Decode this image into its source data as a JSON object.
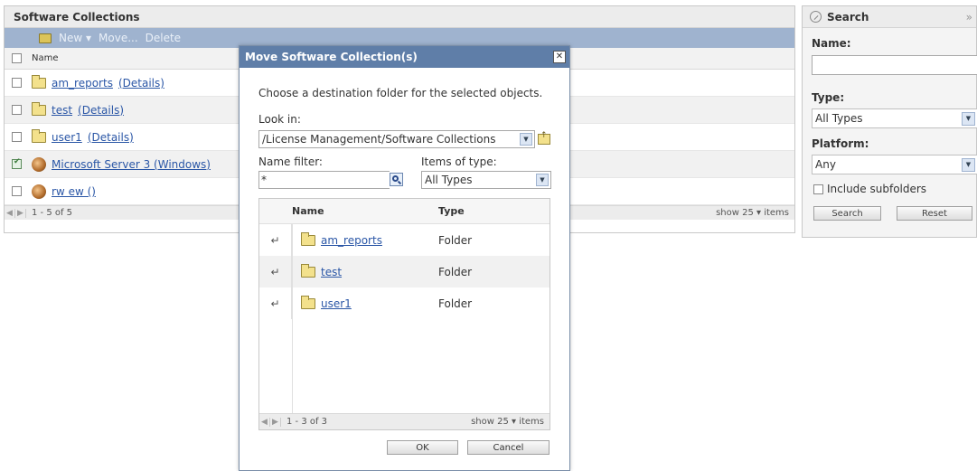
{
  "main": {
    "title": "Software Collections",
    "toolbar": {
      "new": "New ▾",
      "move": "Move...",
      "delete": "Delete"
    },
    "column_name": "Name",
    "rows": [
      {
        "name": "am_reports",
        "details": "(Details)",
        "checked": false
      },
      {
        "name": "test",
        "details": "(Details)",
        "checked": false
      },
      {
        "name": "user1",
        "details": "(Details)",
        "checked": false
      },
      {
        "name": "Microsoft Server 3 (Windows)",
        "details": "",
        "checked": true
      },
      {
        "name": "rw ew ()",
        "details": "",
        "checked": false
      }
    ],
    "pager_text": "1 - 5 of 5",
    "show_text": "show  25 ▾  items"
  },
  "search": {
    "title": "Search",
    "collapse": "»",
    "name_label": "Name:",
    "name_value": "",
    "type_label": "Type:",
    "type_value": "All Types",
    "platform_label": "Platform:",
    "platform_value": "Any",
    "subfolders_label": "Include subfolders",
    "search_button": "Search",
    "reset_button": "Reset"
  },
  "dialog": {
    "title": "Move Software Collection(s)",
    "close": "✕",
    "instruction": "Choose a destination folder for the selected objects.",
    "look_in_label": "Look in:",
    "look_in_value": "/License Management/Software Collections",
    "name_filter_label": "Name filter:",
    "name_filter_value": "*",
    "items_of_type_label": "Items of type:",
    "items_of_type_value": "All Types",
    "col_name": "Name",
    "col_type": "Type",
    "rows": [
      {
        "name": "am_reports",
        "type": "Folder"
      },
      {
        "name": "test",
        "type": "Folder"
      },
      {
        "name": "user1",
        "type": "Folder"
      }
    ],
    "pager_text": "1 - 3 of 3",
    "show_text": "show  25 ▾  items",
    "ok_button": "OK",
    "cancel_button": "Cancel"
  }
}
